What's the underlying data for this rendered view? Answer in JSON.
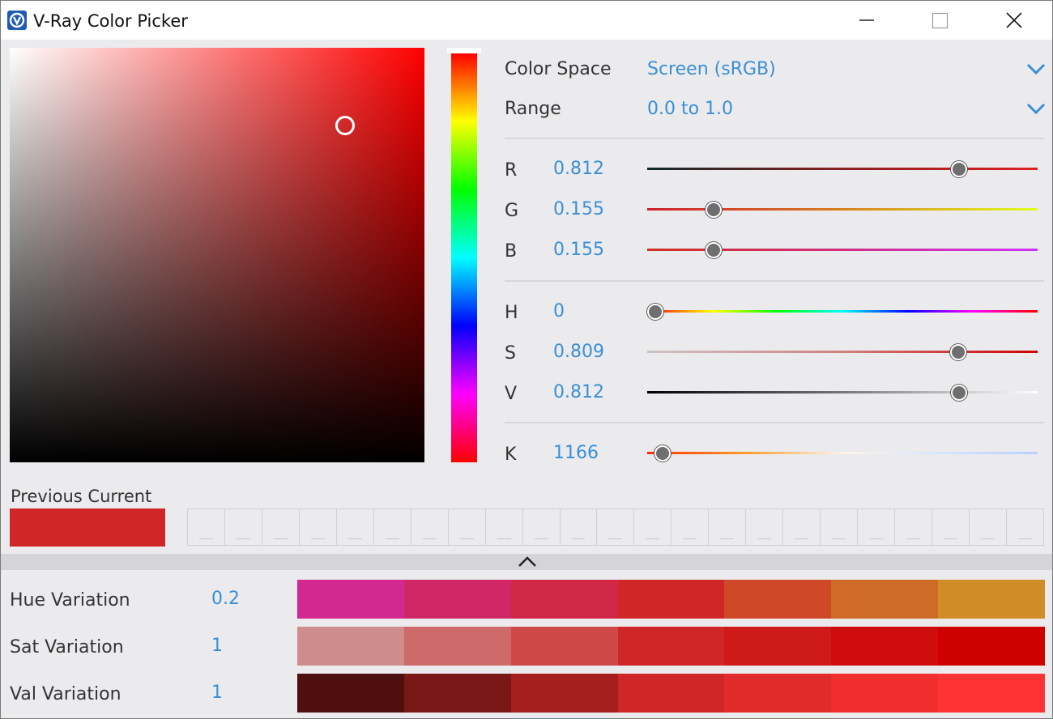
{
  "window": {
    "title": "V-Ray Color Picker",
    "icon": "vray-logo-icon",
    "controls": [
      "minimize-icon",
      "maximize-icon",
      "close-icon"
    ]
  },
  "picker": {
    "hue_degrees": 0,
    "saturation": 0.809,
    "value": 0.812
  },
  "settings": {
    "color_space_label": "Color Space",
    "color_space_value": "Screen (sRGB)",
    "range_label": "Range",
    "range_value": "0.0 to 1.0"
  },
  "channels": {
    "r": {
      "label": "R",
      "value": "0.812",
      "fraction": 0.812
    },
    "g": {
      "label": "G",
      "value": "0.155",
      "fraction": 0.155
    },
    "b": {
      "label": "B",
      "value": "0.155",
      "fraction": 0.155
    },
    "h": {
      "label": "H",
      "value": "0",
      "fraction": 0
    },
    "s": {
      "label": "S",
      "value": "0.809",
      "fraction": 0.809
    },
    "v": {
      "label": "V",
      "value": "0.812",
      "fraction": 0.812
    },
    "k": {
      "label": "K",
      "value": "1166",
      "fraction": 0.02
    }
  },
  "swatches": {
    "label": "Previous Current",
    "current_color": "#cf2727",
    "history_slots": 23
  },
  "variations": {
    "hue": {
      "label": "Hue Variation",
      "value": "0.2",
      "colors": [
        "#d3288f",
        "#d02867",
        "#cf2745",
        "#cf2727",
        "#cf4827",
        "#cf6a27",
        "#cf8c27"
      ]
    },
    "sat": {
      "label": "Sat Variation",
      "value": "1",
      "colors": [
        "#cf8c8c",
        "#cf6a6a",
        "#cf4848",
        "#cf2727",
        "#cf1a1a",
        "#cf0d0d",
        "#cf0000"
      ]
    },
    "val": {
      "label": "Val Variation",
      "value": "1",
      "colors": [
        "#4f0f0f",
        "#7a1717",
        "#a51f1f",
        "#cf2727",
        "#e12b2b",
        "#f02e2e",
        "#ff3333"
      ]
    }
  }
}
